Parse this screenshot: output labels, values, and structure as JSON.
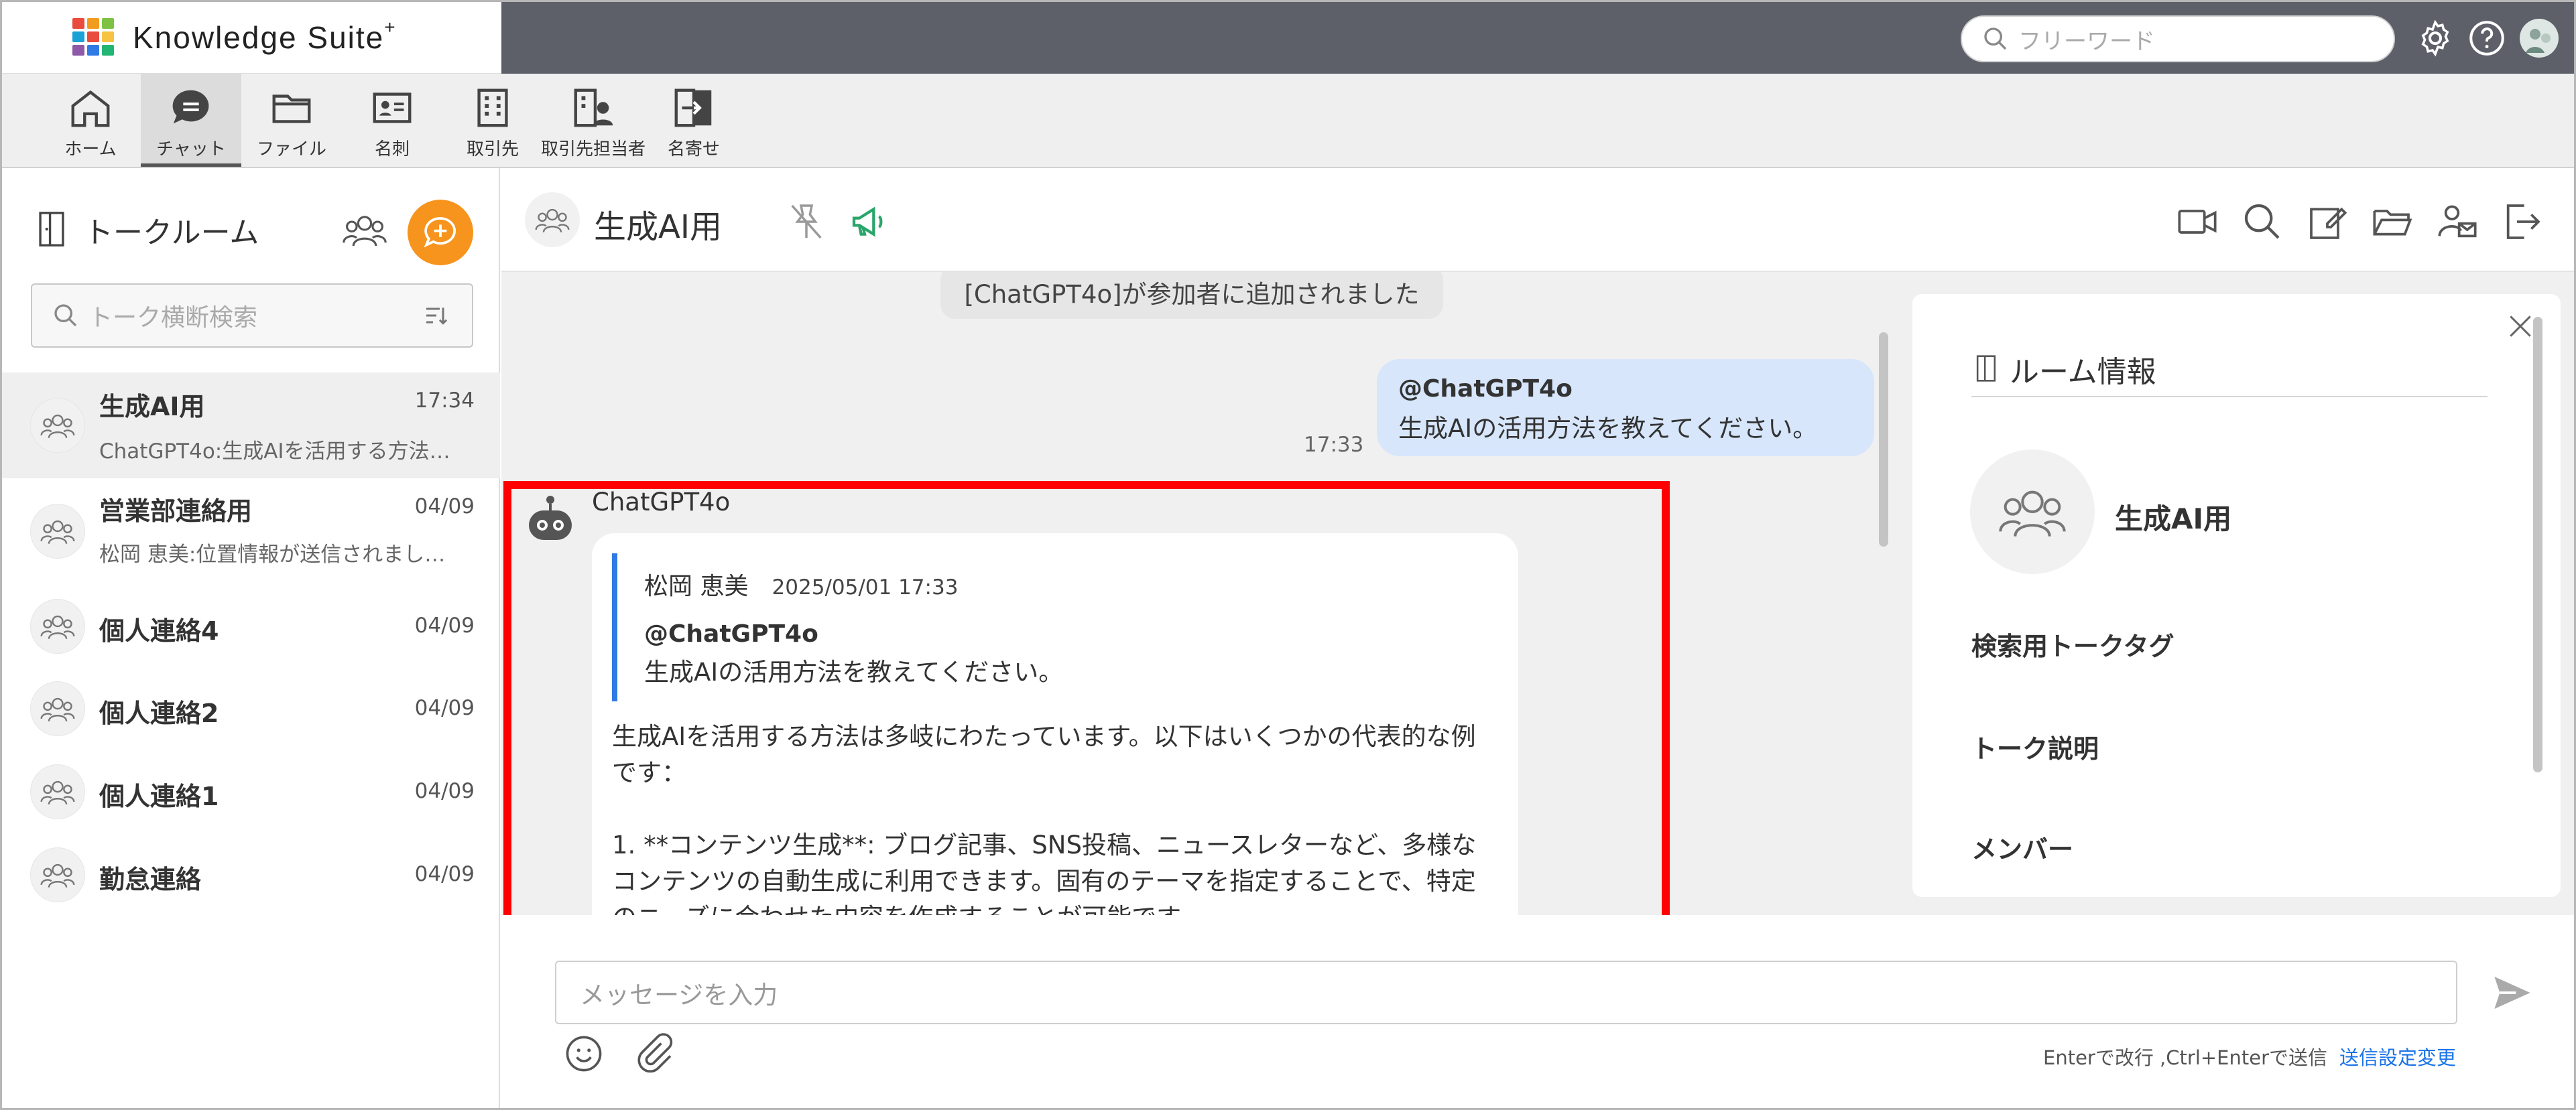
{
  "app": {
    "name": "Knowledge Suite",
    "name_suffix": "+",
    "logo_colors": [
      "#e94b3c",
      "#f29c1f",
      "#7dc242",
      "#1aa1d6",
      "#e94b3c",
      "#f6c343",
      "#8e5aa8",
      "#2f7be5",
      "#22b573"
    ]
  },
  "topbar": {
    "search_placeholder": "フリーワード",
    "icons": [
      "gear-icon",
      "help-icon",
      "avatar"
    ]
  },
  "nav": {
    "items": [
      {
        "label": "ホーム",
        "icon": "home-icon"
      },
      {
        "label": "チャット",
        "icon": "chat-icon",
        "active": true
      },
      {
        "label": "ファイル",
        "icon": "folder-icon"
      },
      {
        "label": "名刺",
        "icon": "business-card-icon"
      },
      {
        "label": "取引先",
        "icon": "building-icon"
      },
      {
        "label": "取引先担当者",
        "icon": "contact-person-icon"
      },
      {
        "label": "名寄せ",
        "icon": "merge-icon"
      }
    ]
  },
  "sidebar": {
    "title": "トークルーム",
    "search_placeholder": "トーク横断検索",
    "accent_color": "#f7941d",
    "rooms": [
      {
        "name": "生成AI用",
        "date": "17:34",
        "preview": "ChatGPT4o:生成AIを活用する方法…",
        "active": true
      },
      {
        "name": "営業部連絡用",
        "date": "04/09",
        "preview": "松岡 恵美:位置情報が送信されまし…"
      },
      {
        "name": "個人連絡4",
        "date": "04/09"
      },
      {
        "name": "個人連絡2",
        "date": "04/09"
      },
      {
        "name": "個人連絡1",
        "date": "04/09"
      },
      {
        "name": "勤怠連絡",
        "date": "04/09"
      }
    ]
  },
  "chat": {
    "title": "生成AI用",
    "header_icons": [
      "pin-off-icon",
      "megaphone-icon",
      "video-icon",
      "search-icon",
      "edit-icon",
      "folder-open-icon",
      "member-mail-icon",
      "exit-icon"
    ],
    "system_message": "[ChatGPT4o]が参加者に追加されました",
    "my_message": {
      "mention": "@ChatGPT4o",
      "text": "生成AIの活用方法を教えてください。",
      "time": "17:33",
      "bubble_color": "#d7e6fb"
    },
    "bot_message": {
      "sender": "ChatGPT4o",
      "quote": {
        "author": "松岡 恵美",
        "datetime": "2025/05/01 17:33",
        "mention": "@ChatGPT4o",
        "text": "生成AIの活用方法を教えてください。"
      },
      "body": "生成AIを活用する方法は多岐にわたっています。以下はいくつかの代表的な例です：\n\n1. **コンテンツ生成**: ブログ記事、SNS投稿、ニュースレターなど、多様なコンテンツの自動生成に利用できます。固有のテーマを指定することで、特定のニーズに合わせた内容を作成することが可能です。"
    },
    "highlight_color": "#ff0000"
  },
  "info_panel": {
    "title": "ルーム情報",
    "room_name": "生成AI用",
    "sections": [
      "検索用トークタグ",
      "トーク説明",
      "メンバー"
    ]
  },
  "composer": {
    "placeholder": "メッセージを入力",
    "hint": "Enterで改行 ,Ctrl+Enterで送信",
    "settings_link": "送信設定変更"
  }
}
